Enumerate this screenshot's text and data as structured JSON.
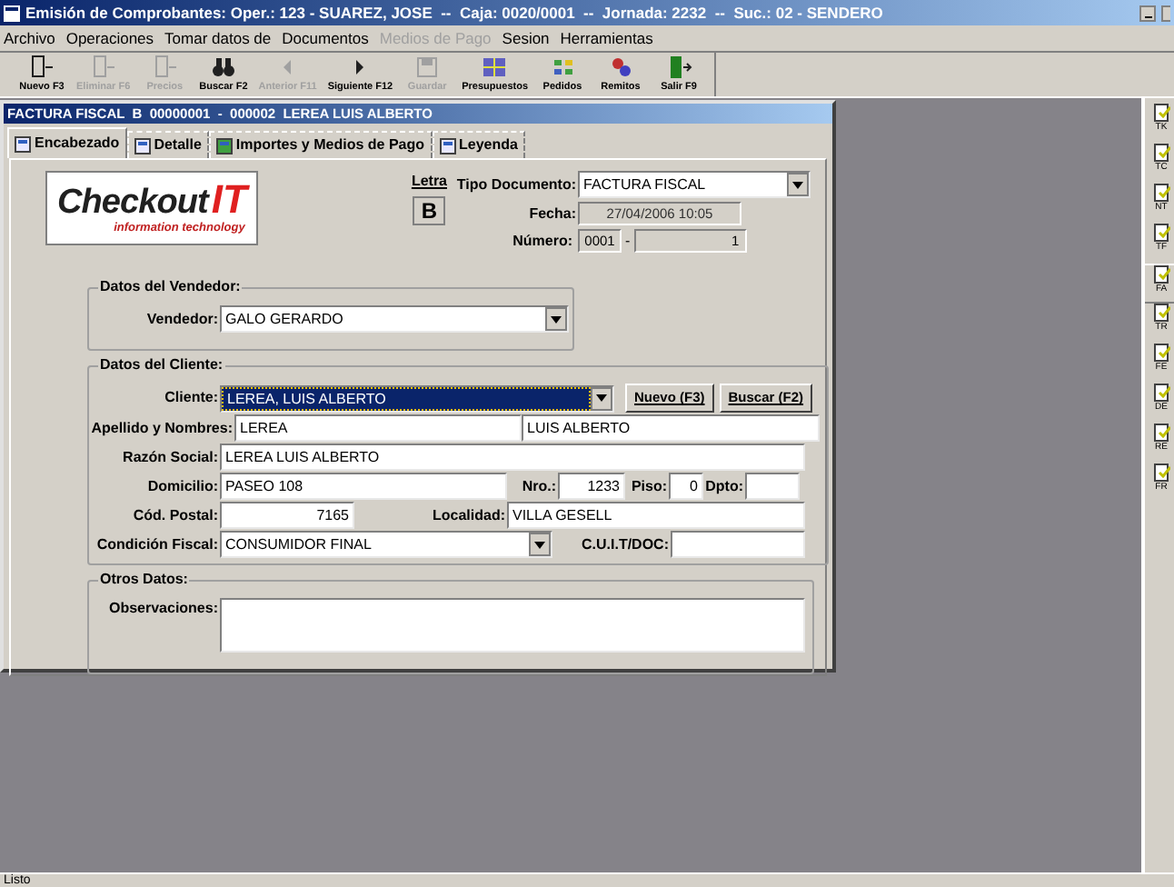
{
  "window": {
    "title": "Emisión de Comprobantes: Oper.: 123 - SUAREZ, JOSE  --  Caja: 0020/0001  --  Jornada: 2232  --  Suc.: 02 - SENDERO"
  },
  "menu": [
    {
      "label": "Archivo",
      "disabled": false
    },
    {
      "label": "Operaciones",
      "disabled": false
    },
    {
      "label": "Tomar datos de",
      "disabled": false
    },
    {
      "label": "Documentos",
      "disabled": false
    },
    {
      "label": "Medios de Pago",
      "disabled": true
    },
    {
      "label": "Sesion",
      "disabled": false
    },
    {
      "label": "Herramientas",
      "disabled": false
    }
  ],
  "toolbar": [
    {
      "label": "Nuevo F3",
      "kind": "new",
      "disabled": false
    },
    {
      "label": "Eliminar F6",
      "kind": "delete",
      "disabled": true
    },
    {
      "label": "Precios",
      "kind": "prices",
      "disabled": true
    },
    {
      "label": "Buscar F2",
      "kind": "search",
      "disabled": false
    },
    {
      "label": "Anterior F11",
      "kind": "prev",
      "disabled": true
    },
    {
      "label": "Siguiente F12",
      "kind": "next",
      "disabled": false
    },
    {
      "label": "Guardar",
      "kind": "save",
      "disabled": true
    },
    {
      "label": "Presupuestos",
      "kind": "quotes",
      "disabled": false
    },
    {
      "label": "Pedidos",
      "kind": "orders",
      "disabled": false
    },
    {
      "label": "Remitos",
      "kind": "dispatch",
      "disabled": false
    },
    {
      "label": "Salir F9",
      "kind": "exit",
      "disabled": false
    }
  ],
  "document": {
    "title": "FACTURA FISCAL  B  00000001  -  000002  LEREA LUIS ALBERTO",
    "tabs": [
      {
        "label": "Encabezado",
        "selected": true
      },
      {
        "label": "Detalle",
        "selected": false
      },
      {
        "label": "Importes y Medios de Pago",
        "selected": false
      },
      {
        "label": "Leyenda",
        "selected": false
      }
    ],
    "logo": {
      "brand": "Checkout",
      "accent": "IT",
      "tagline": "information technology"
    },
    "letra": {
      "label": "Letra",
      "value": "B"
    },
    "tipo_documento": {
      "label": "Tipo Documento:",
      "value": "FACTURA FISCAL"
    },
    "fecha": {
      "label": "Fecha:",
      "value": "27/04/2006 10:05"
    },
    "numero": {
      "label": "Número:",
      "value_1": "0001",
      "separator": "-",
      "value_2": "1"
    },
    "vendedor_group": {
      "title": "Datos del Vendedor:",
      "label": "Vendedor:",
      "value": "GALO GERARDO"
    },
    "cliente_group": {
      "title": "Datos del Cliente:",
      "cliente": {
        "label": "Cliente:",
        "value": "LEREA, LUIS ALBERTO",
        "focused": true
      },
      "buttons": [
        {
          "label": "Nuevo (F3)"
        },
        {
          "label": "Buscar (F2)"
        }
      ],
      "apellido": {
        "label": "Apellido y Nombres:",
        "value_1": "LEREA",
        "value_2": "LUIS ALBERTO"
      },
      "razon_social": {
        "label": "Razón Social:",
        "value": "LEREA LUIS ALBERTO"
      },
      "domicilio": {
        "label": "Domicilio:",
        "value": "PASEO 108"
      },
      "nro": {
        "label": "Nro.:",
        "value": "1233"
      },
      "piso": {
        "label": "Piso:",
        "value": "0"
      },
      "dpto": {
        "label": "Dpto:"
      },
      "cod_postal": {
        "label": "Cód. Postal:",
        "value": "7165"
      },
      "localidad": {
        "label": "Localidad:",
        "value": "VILLA GESELL"
      },
      "condicion_fiscal": {
        "label": "Condición Fiscal:",
        "value": "CONSUMIDOR FINAL"
      },
      "cuit": {
        "label": "C.U.I.T/DOC:"
      }
    },
    "otros_group": {
      "title": "Otros Datos:",
      "label": "Observaciones:"
    }
  },
  "side_panel": [
    {
      "label": "TK",
      "selected": false
    },
    {
      "label": "TC",
      "selected": false
    },
    {
      "label": "NT",
      "selected": false
    },
    {
      "label": "TF",
      "selected": false
    },
    {
      "label": "FA",
      "selected": true
    },
    {
      "label": "TR",
      "selected": false
    },
    {
      "label": "FE",
      "selected": false
    },
    {
      "label": "DE",
      "selected": false
    },
    {
      "label": "RE",
      "selected": false
    },
    {
      "label": "FR",
      "selected": false
    }
  ],
  "status_bar": "Listo"
}
